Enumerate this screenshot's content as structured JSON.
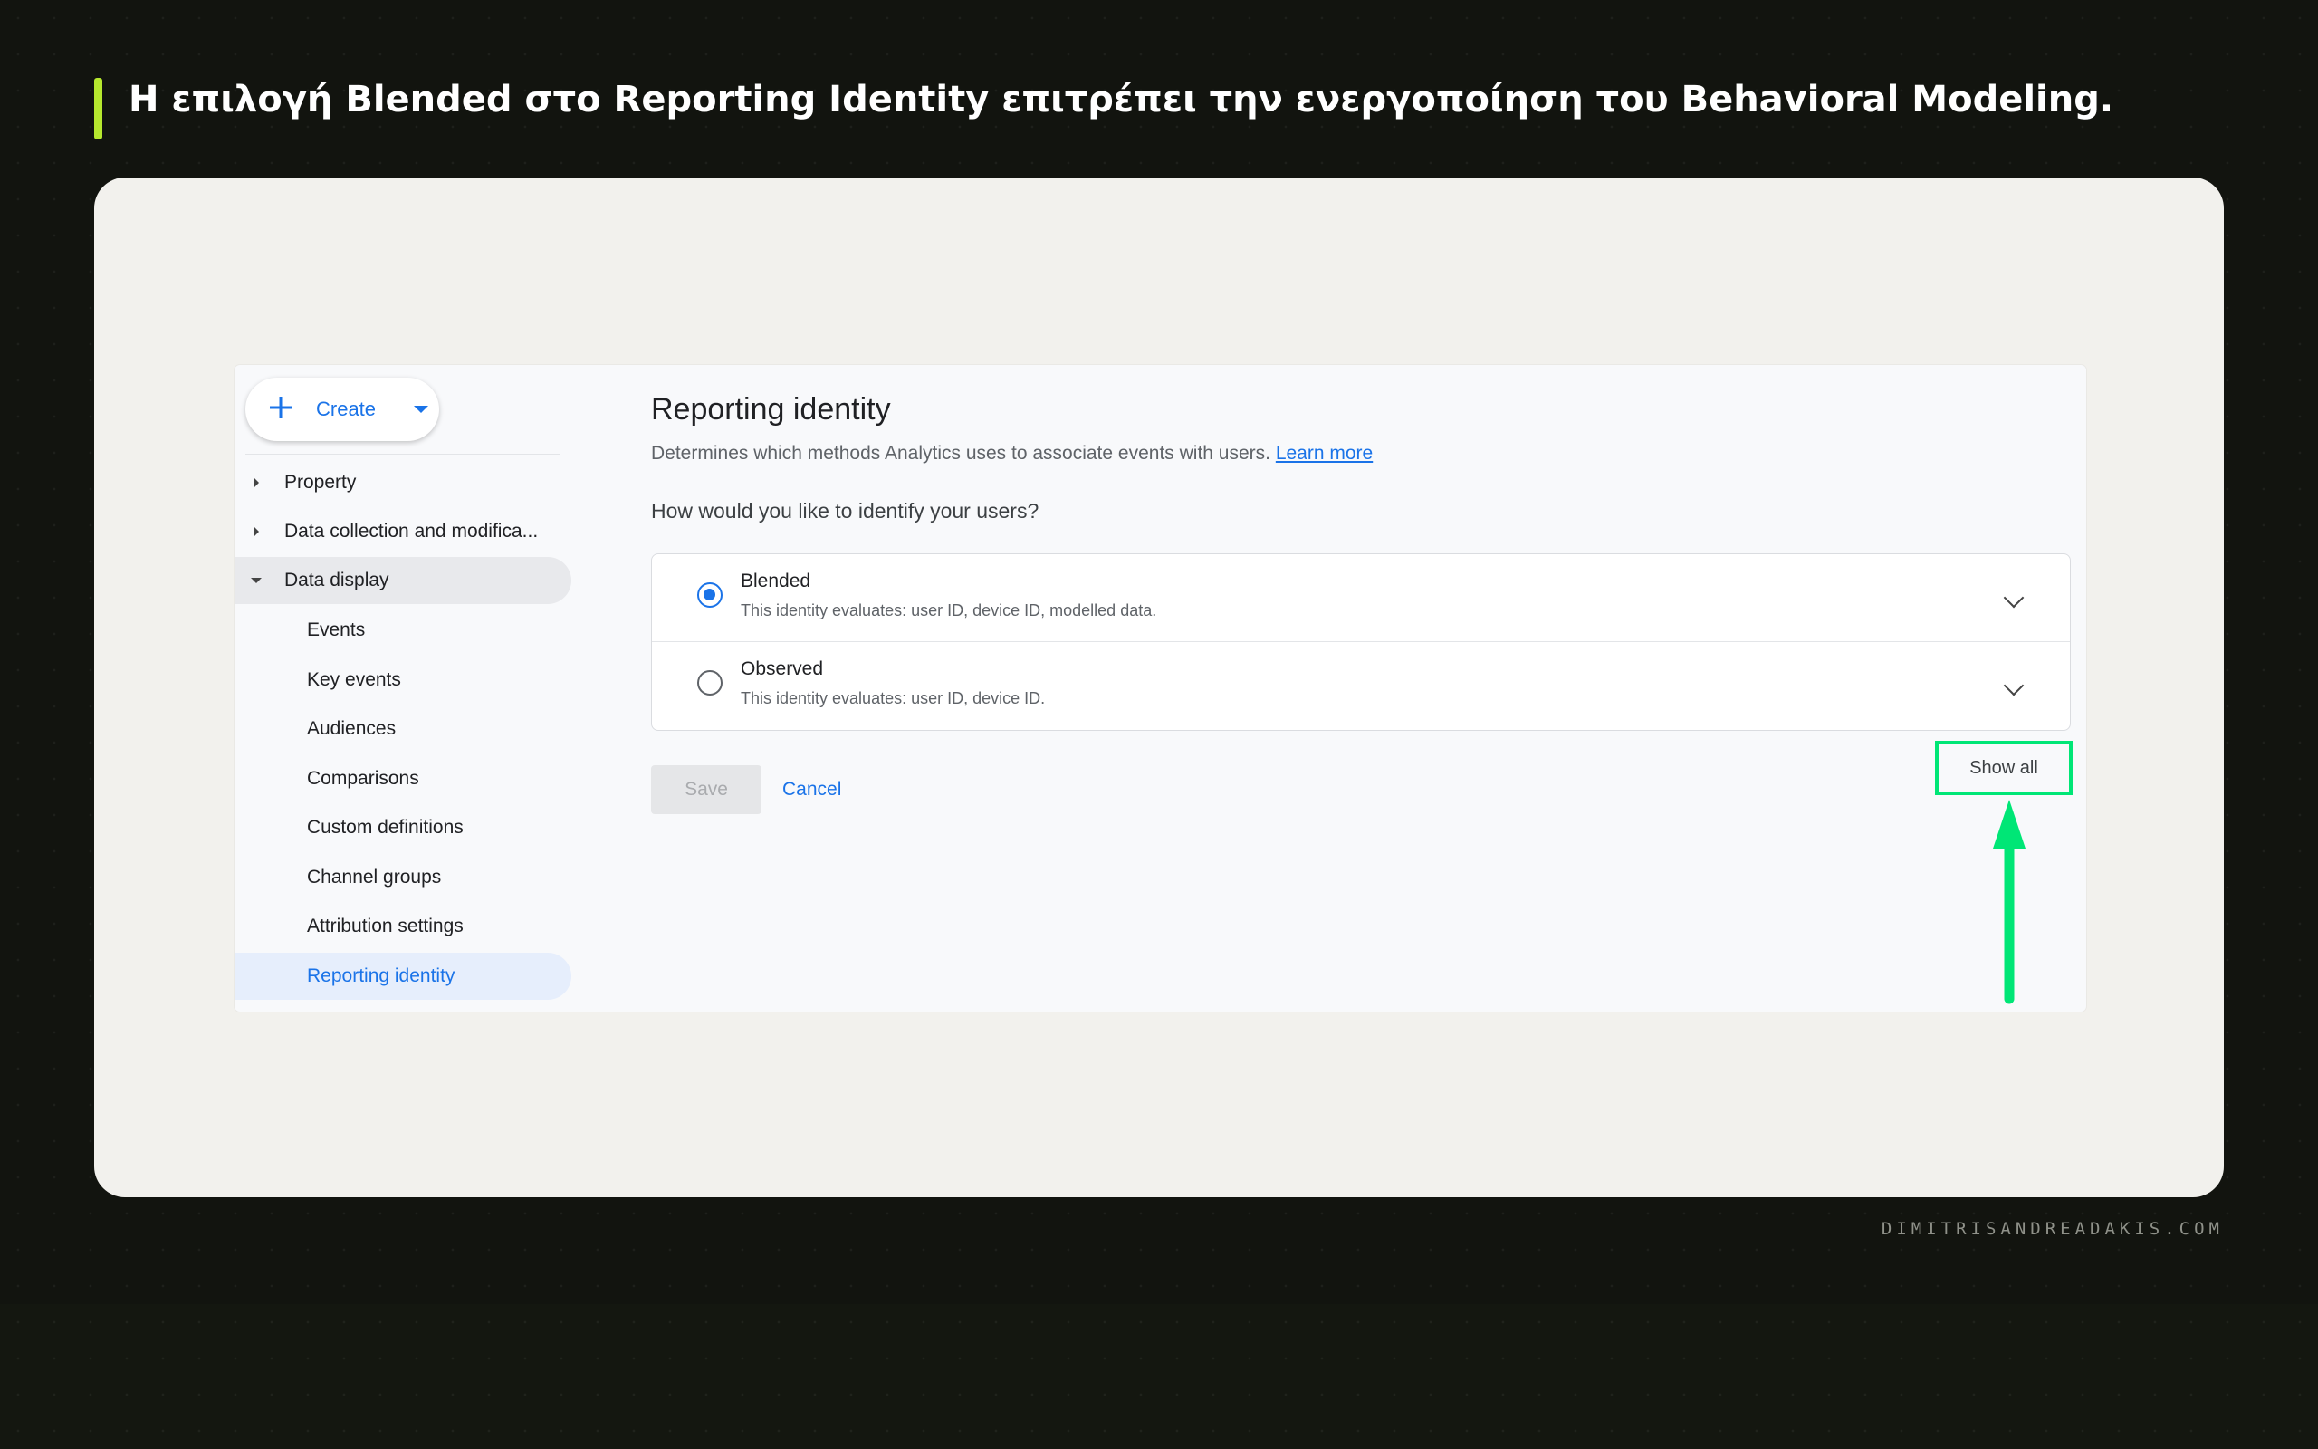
{
  "slide": {
    "heading": "Η επιλογή Blended στο Reporting Identity επιτρέπει την ενεργοποίηση του Behavioral Modeling.",
    "watermark": "DIMITRISANDREADAKIS.COM"
  },
  "colors": {
    "accent_bar": "#b6e82e",
    "highlight": "#00e676",
    "link": "#1a73e8"
  },
  "ga": {
    "create_label": "Create",
    "sidebar": {
      "items": [
        {
          "label": "Property",
          "icon": "caret-right-icon"
        },
        {
          "label": "Data collection and modifica...",
          "icon": "caret-right-icon"
        },
        {
          "label": "Data display",
          "icon": "caret-down-icon"
        }
      ],
      "subitems": [
        "Events",
        "Key events",
        "Audiences",
        "Comparisons",
        "Custom definitions",
        "Channel groups",
        "Attribution settings",
        "Reporting identity"
      ]
    },
    "main": {
      "title": "Reporting identity",
      "description": "Determines which methods Analytics uses to associate events with users.",
      "learn_more": "Learn more",
      "question": "How would you like to identify your users?",
      "options": [
        {
          "name": "Blended",
          "desc": "This identity evaluates: user ID, device ID, modelled data.",
          "selected": true
        },
        {
          "name": "Observed",
          "desc": "This identity evaluates: user ID, device ID.",
          "selected": false
        }
      ],
      "save": "Save",
      "cancel": "Cancel",
      "show_all": "Show all"
    }
  }
}
